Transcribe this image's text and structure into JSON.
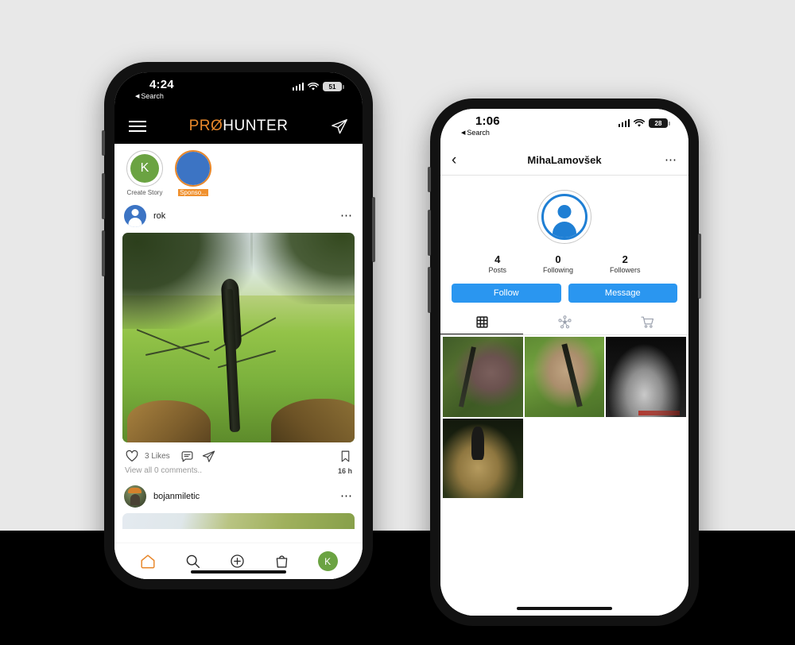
{
  "background": {
    "top_color": "#e8e8e8",
    "bottom_color": "#000000"
  },
  "phones": {
    "left": {
      "status_bar": {
        "time": "4:24",
        "back_label": "Search",
        "back_arrow": "◀",
        "battery_level": "51",
        "icons": [
          "signal-bars-icon",
          "wifi-icon",
          "battery-icon"
        ]
      },
      "header": {
        "menu_icon": "hamburger-menu-icon",
        "logo_accent": "PRØ",
        "logo_rest": "HUNTER",
        "logo_accent_color": "#e8872a",
        "share_icon": "paper-plane-icon"
      },
      "stories": [
        {
          "label": "Create Story",
          "initial": "K",
          "ring": "plain",
          "avatar_color": "#6ba342",
          "highlighted": false
        },
        {
          "label": "Sponso...",
          "initial": "",
          "ring": "sponsored",
          "avatar_color": "#3c74c4",
          "highlighted": true
        }
      ],
      "posts": [
        {
          "username": "rok",
          "avatar_type": "default-person-avatar",
          "more_icon": "more-options-icon",
          "likes": "3 Likes",
          "comments": "View all 0 comments..",
          "timestamp": "16 h",
          "actions": [
            "like-heart-icon",
            "comment-bubble-icon",
            "share-plane-icon",
            "bookmark-icon"
          ]
        },
        {
          "username": "bojanmiletic",
          "avatar_type": "photo-avatar",
          "more_icon": "more-options-icon"
        }
      ],
      "tabbar": [
        {
          "name": "home-icon",
          "active": true,
          "color": "#e8872a"
        },
        {
          "name": "search-icon",
          "active": false
        },
        {
          "name": "add-post-icon",
          "active": false
        },
        {
          "name": "shop-bag-icon",
          "active": false
        },
        {
          "name": "profile-avatar",
          "initial": "K",
          "color": "#6ba342",
          "active": false
        }
      ]
    },
    "right": {
      "status_bar": {
        "time": "1:06",
        "back_label": "Search",
        "back_arrow": "◀",
        "battery_level": "28",
        "icons": [
          "signal-bars-icon",
          "wifi-icon",
          "battery-icon"
        ]
      },
      "nav": {
        "back_icon": "back-chevron-icon",
        "title": "MihaLamovšek",
        "more_icon": "more-options-icon"
      },
      "avatar_type": "default-person-avatar",
      "stats": [
        {
          "value": "4",
          "label": "Posts"
        },
        {
          "value": "0",
          "label": "Following"
        },
        {
          "value": "2",
          "label": "Followers"
        }
      ],
      "buttons": [
        {
          "label": "Follow",
          "color": "#2a96f0"
        },
        {
          "label": "Message",
          "color": "#2a96f0"
        }
      ],
      "tabs": [
        {
          "icon": "grid-view-icon",
          "active": true
        },
        {
          "icon": "network-nodes-icon",
          "active": false
        },
        {
          "icon": "shopping-cart-icon",
          "active": false
        }
      ],
      "grid_photos": [
        {
          "id": "photo-1",
          "description": "harvested animal on forest ground with rifle"
        },
        {
          "id": "photo-2",
          "description": "roe deer on grass with rifle and scope"
        },
        {
          "id": "photo-3",
          "description": "night trail camera image of animal"
        },
        {
          "id": "photo-4",
          "description": "hunter posing with antlered deer at night"
        }
      ]
    }
  }
}
